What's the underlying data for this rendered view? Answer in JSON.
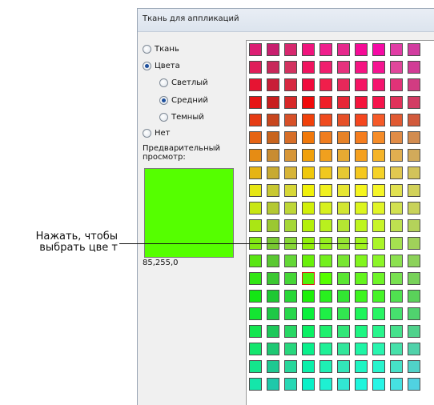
{
  "dialog": {
    "title": "Ткань для аппликаций"
  },
  "options": {
    "fabric": "Ткань",
    "colors": "Цвета",
    "light": "Светлый",
    "medium": "Средний",
    "dark": "Темный",
    "none": "Нет",
    "selected_source": "colors",
    "selected_shade": "medium"
  },
  "preview": {
    "label_line1": "Предварительный",
    "label_line2": "просмотр:",
    "color": "#55ff00",
    "rgb": "85,255,0"
  },
  "palette": {
    "selected_cell": {
      "row": 13,
      "col": 3
    },
    "rows": [
      [
        "#dc1e73",
        "#c81e6e",
        "#d7286e",
        "#f0147d",
        "#f01e8c",
        "#e6288c",
        "#f50a96",
        "#f50aa5",
        "#e13ca5",
        "#d23ca0"
      ],
      [
        "#e01e5a",
        "#c8285a",
        "#d2325f",
        "#f0145f",
        "#f01e6e",
        "#e6327d",
        "#f51482",
        "#f51491",
        "#e1469b",
        "#d23c96"
      ],
      [
        "#e61432",
        "#c81e37",
        "#d72841",
        "#f00a3c",
        "#f01e4b",
        "#e6285a",
        "#f51464",
        "#f5146e",
        "#e13278",
        "#d23c82"
      ],
      [
        "#e61414",
        "#c81e1e",
        "#d72828",
        "#f00a0a",
        "#f01e28",
        "#e62837",
        "#f5143c",
        "#f5144b",
        "#e1325a",
        "#d23c64"
      ],
      [
        "#e63c14",
        "#c8461e",
        "#d75028",
        "#f0400a",
        "#f04b1e",
        "#e65028",
        "#f5461e",
        "#f55a28",
        "#e15a32",
        "#d25a3c"
      ],
      [
        "#e66414",
        "#c8641e",
        "#d76e28",
        "#f0780a",
        "#f07d1e",
        "#e68228",
        "#f57d1e",
        "#f58c28",
        "#e18c46",
        "#d28c50"
      ],
      [
        "#e68c14",
        "#c88c32",
        "#d79637",
        "#f0a00a",
        "#f0a01e",
        "#e6aa32",
        "#f5a01e",
        "#f5b428",
        "#e1af50",
        "#d2aa5a"
      ],
      [
        "#e6b414",
        "#c8aa32",
        "#d7b437",
        "#f0c80a",
        "#f0c81e",
        "#e6c832",
        "#f5c81e",
        "#f5d228",
        "#e1c850",
        "#d2c35a"
      ],
      [
        "#e6e614",
        "#c8c832",
        "#d7d737",
        "#f0f00a",
        "#f0f01e",
        "#e6e632",
        "#f5f51e",
        "#f5f528",
        "#e1e150",
        "#d2d25a"
      ],
      [
        "#c8e614",
        "#b4c832",
        "#bed737",
        "#d2f00a",
        "#d7f01e",
        "#d2e632",
        "#dcf51e",
        "#e1f528",
        "#d2e150",
        "#c8d25a"
      ],
      [
        "#aae614",
        "#9bc832",
        "#a5d737",
        "#b4f00a",
        "#b9f01e",
        "#b4e632",
        "#bef51e",
        "#c8f528",
        "#bee150",
        "#b4d25a"
      ],
      [
        "#82e614",
        "#78c832",
        "#87d737",
        "#91f00a",
        "#96f01e",
        "#96e632",
        "#a0f51e",
        "#aaf528",
        "#a5e150",
        "#a0d25a"
      ],
      [
        "#5ae614",
        "#5ac832",
        "#64d737",
        "#69f00a",
        "#73f01e",
        "#78e632",
        "#82f51e",
        "#8cf528",
        "#8ce150",
        "#8cd25a"
      ],
      [
        "#32e614",
        "#3cc832",
        "#46d737",
        "#50f00a",
        "#55ff00",
        "#5ae632",
        "#64f51e",
        "#6ef528",
        "#78e150",
        "#78d25a"
      ],
      [
        "#14e614",
        "#1ec832",
        "#28d737",
        "#1ef00a",
        "#28f01e",
        "#32e632",
        "#3cf51e",
        "#46f528",
        "#50e150",
        "#5ad25a"
      ],
      [
        "#14e632",
        "#1ec846",
        "#28d74b",
        "#0af03c",
        "#1ef046",
        "#32e650",
        "#1ef55a",
        "#28f564",
        "#46e16e",
        "#50d26e"
      ],
      [
        "#14e650",
        "#1ec85a",
        "#28d764",
        "#0af064",
        "#1ef06e",
        "#32e678",
        "#1ef582",
        "#28f58c",
        "#46e18c",
        "#50d28c"
      ],
      [
        "#14e66e",
        "#1ec873",
        "#28d77d",
        "#0af08c",
        "#1ef096",
        "#32e69b",
        "#1ef5a5",
        "#28f5af",
        "#46e1aa",
        "#50d2aa"
      ],
      [
        "#14e68c",
        "#1ec891",
        "#28d79b",
        "#0af0aa",
        "#1ef0b4",
        "#32e6b9",
        "#1ef5c3",
        "#28f5cd",
        "#46e1c8",
        "#50d2c8"
      ],
      [
        "#14e6aa",
        "#1ec8aa",
        "#28d7b4",
        "#0af0c8",
        "#1ef0d2",
        "#32e6d2",
        "#1ef5dc",
        "#28f5e6",
        "#46e1e1",
        "#50d2e1"
      ]
    ]
  },
  "annotation": {
    "line1": "Нажать, чтобы",
    "line2": "выбрать цве т"
  }
}
